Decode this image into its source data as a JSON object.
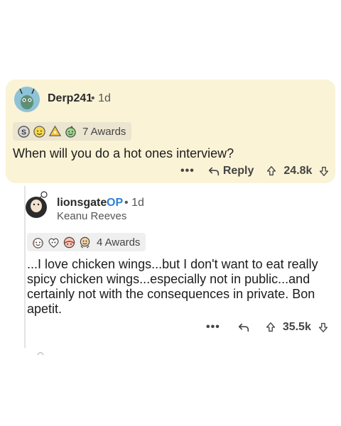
{
  "comment_top": {
    "username": "Derp241",
    "separator": "•",
    "age": "1d",
    "award_icons": [
      "silver-icon",
      "helpful-icon",
      "gold-award-icon",
      "wholesome-icon"
    ],
    "awards_label": "7 Awards",
    "body": "When will you do a hot ones interview?",
    "more_label": "•••",
    "reply_label": "Reply",
    "score": "24.8k"
  },
  "comment_reply": {
    "username": "lionsgate",
    "op_badge": "OP",
    "separator": "•",
    "age": "1d",
    "flair": "Keanu Reeves",
    "award_icons": [
      "wholesome-icon",
      "heart-eyes-icon",
      "hugz-icon",
      "bravo-icon"
    ],
    "awards_label": "4 Awards",
    "body": "...I love chicken wings...but I don't want to eat really spicy chicken wings...especially not in public...and certainly not with the consequences in private. Bon apetit.",
    "more_label": "•••",
    "score": "35.5k"
  },
  "colors": {
    "highlight_bg": "#fbf3d6",
    "op_blue": "#2f7fd6",
    "text": "#1c1c1c",
    "meta": "#555555"
  }
}
